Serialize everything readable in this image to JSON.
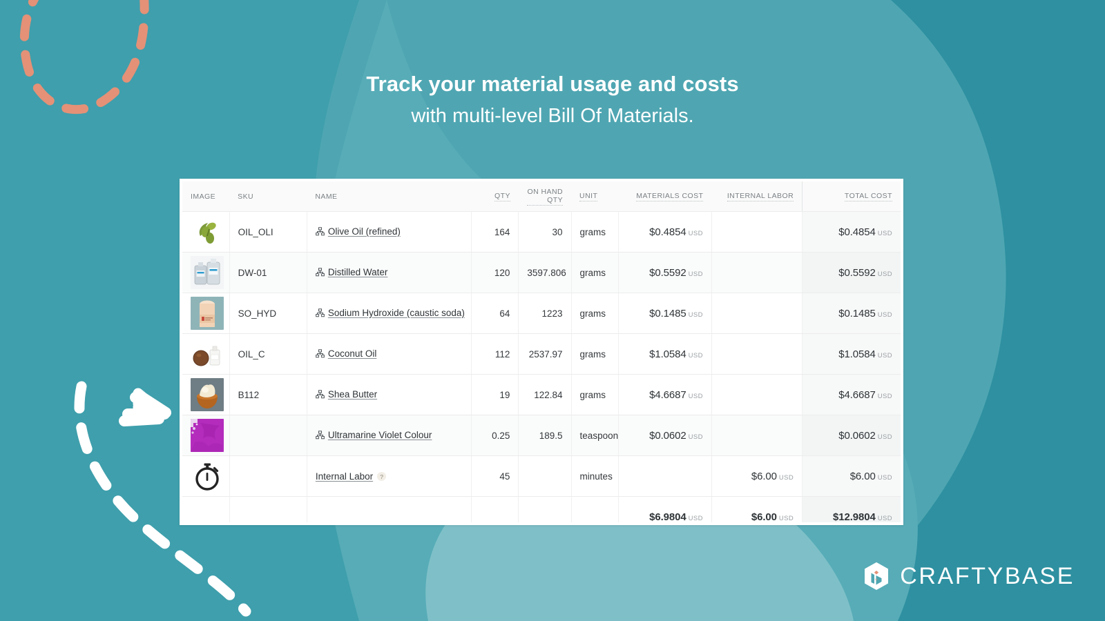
{
  "theme": {
    "bg_teal": "#4FA6B2",
    "bg_teal_dark": "#2E90A0",
    "bg_teal_light": "#79BDC6",
    "accent_coral": "#E49177",
    "white": "#FFFFFF"
  },
  "headline": {
    "line1": "Track your material usage and costs",
    "line2": "with multi-level Bill Of Materials."
  },
  "table": {
    "columns": [
      {
        "key": "image",
        "label": "IMAGE",
        "tooltip": false
      },
      {
        "key": "sku",
        "label": "SKU",
        "tooltip": false
      },
      {
        "key": "name",
        "label": "NAME",
        "tooltip": false
      },
      {
        "key": "qty",
        "label": "QTY",
        "tooltip": true
      },
      {
        "key": "onhand",
        "label": "ON HAND QTY",
        "tooltip": true
      },
      {
        "key": "unit",
        "label": "UNIT",
        "tooltip": true
      },
      {
        "key": "mat",
        "label": "MATERIALS COST",
        "tooltip": true
      },
      {
        "key": "lab",
        "label": "INTERNAL LABOR",
        "tooltip": true
      },
      {
        "key": "total",
        "label": "TOTAL COST",
        "tooltip": true
      }
    ],
    "currency": "USD",
    "rows": [
      {
        "image": "olive-oil-thumb",
        "sku": "OIL_OLI",
        "name": "Olive Oil (refined)",
        "has_bom_icon": true,
        "qty": "164",
        "onhand": "30",
        "unit": "grams",
        "materials_cost": "$0.4854",
        "internal_labor": "",
        "total_cost": "$0.4854"
      },
      {
        "image": "distilled-water-thumb",
        "sku": "DW-01",
        "name": "Distilled Water",
        "has_bom_icon": true,
        "qty": "120",
        "onhand": "3597.806",
        "unit": "grams",
        "materials_cost": "$0.5592",
        "internal_labor": "",
        "total_cost": "$0.5592"
      },
      {
        "image": "sodium-hydroxide-thumb",
        "sku": "SO_HYD",
        "name": "Sodium Hydroxide (caustic soda)",
        "has_bom_icon": true,
        "qty": "64",
        "onhand": "1223",
        "unit": "grams",
        "materials_cost": "$0.1485",
        "internal_labor": "",
        "total_cost": "$0.1485"
      },
      {
        "image": "coconut-oil-thumb",
        "sku": "OIL_C",
        "name": "Coconut Oil",
        "has_bom_icon": true,
        "qty": "112",
        "onhand": "2537.97",
        "unit": "grams",
        "materials_cost": "$1.0584",
        "internal_labor": "",
        "total_cost": "$1.0584"
      },
      {
        "image": "shea-butter-thumb",
        "sku": "B112",
        "name": "Shea Butter",
        "has_bom_icon": true,
        "qty": "19",
        "onhand": "122.84",
        "unit": "grams",
        "materials_cost": "$4.6687",
        "internal_labor": "",
        "total_cost": "$4.6687"
      },
      {
        "image": "ultramarine-violet-thumb",
        "sku": "",
        "name": "Ultramarine Violet Colour",
        "has_bom_icon": true,
        "qty": "0.25",
        "onhand": "189.5",
        "unit": "teaspoon",
        "materials_cost": "$0.0602",
        "internal_labor": "",
        "total_cost": "$0.0602"
      },
      {
        "image": "stopwatch-icon",
        "sku": "",
        "name": "Internal Labor",
        "has_bom_icon": false,
        "has_help_badge": true,
        "help_badge": "?",
        "qty": "45",
        "onhand": "",
        "unit": "minutes",
        "materials_cost": "",
        "internal_labor": "$6.00",
        "total_cost": "$6.00"
      }
    ],
    "totals": {
      "materials_cost": "$6.9804",
      "internal_labor": "$6.00",
      "total_cost": "$12.9804"
    }
  },
  "logo": {
    "text": "CRAFTYBASE",
    "mark": "craftybase-cube-icon"
  }
}
